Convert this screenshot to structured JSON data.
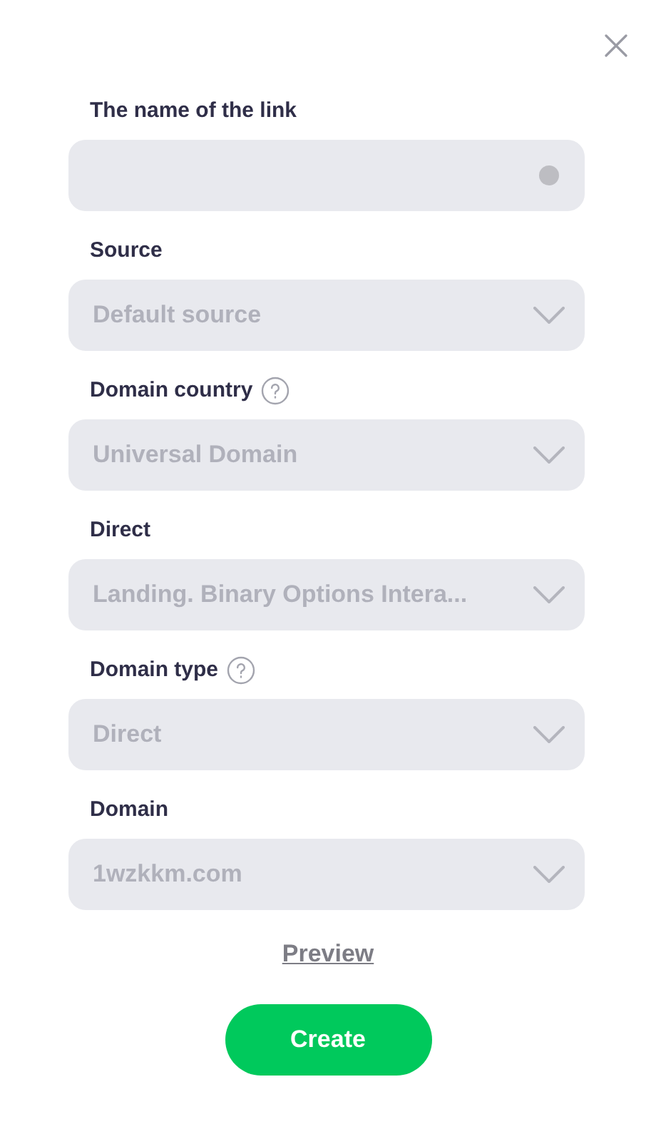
{
  "fields": [
    {
      "kind": "text",
      "label": "The name of the link",
      "help": false
    },
    {
      "kind": "select",
      "label": "Source",
      "help": false,
      "value": "Default source"
    },
    {
      "kind": "select",
      "label": "Domain country",
      "help": true,
      "value": "Universal Domain"
    },
    {
      "kind": "select",
      "label": "Direct",
      "help": false,
      "value": "Landing. Binary Options Intera..."
    },
    {
      "kind": "select",
      "label": "Domain type",
      "help": true,
      "value": "Direct"
    },
    {
      "kind": "select",
      "label": "Domain",
      "help": false,
      "value": "1wzkkm.com"
    }
  ],
  "preview_link": "Preview",
  "create_button": "Create"
}
